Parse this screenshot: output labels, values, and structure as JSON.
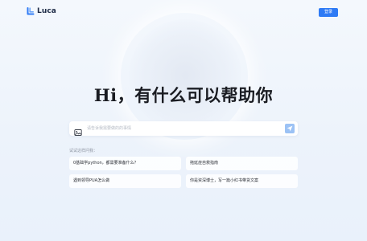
{
  "app": {
    "name": "Luca",
    "login_label": "登录"
  },
  "hero": {
    "headline": "Hi，有什么可以帮助你"
  },
  "search": {
    "placeholder": "请告诉我需要做的的事情",
    "value": ""
  },
  "suggestions": {
    "label": "试试这样问我：",
    "items": [
      "0基础学python，都需要准备什么？",
      "拖延症自救指南",
      "遇到领导PUA怎么做",
      "你是资深博士，写一篇小红书带货文案"
    ]
  },
  "colors": {
    "brand": "#2f7bf5",
    "send_button": "#9cc2f5"
  },
  "icons": {
    "logo": "luca-logo-icon",
    "attach": "image-upload-icon",
    "send": "send-icon"
  }
}
